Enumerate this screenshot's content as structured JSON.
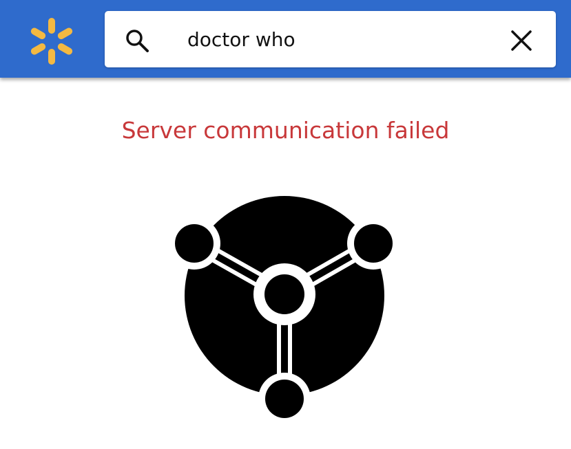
{
  "header": {
    "logo_icon": "spark-logo-icon",
    "brand_color": "#2f6bcc",
    "logo_color": "#f4b942"
  },
  "search": {
    "icon": "search-icon",
    "value": "doctor who",
    "clear_icon": "close-icon"
  },
  "main": {
    "error_message": "Server communication failed",
    "error_color": "#c8383a",
    "illustration_icon": "network-disconnected-icon"
  }
}
